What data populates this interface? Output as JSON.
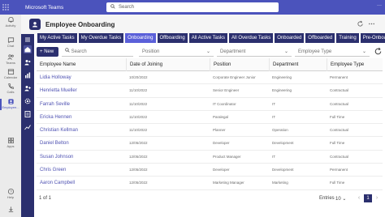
{
  "teams": {
    "app_name": "Microsoft Teams",
    "search_placeholder": "Search",
    "window_controls": "···",
    "rail": [
      {
        "label": "Activity",
        "icon": "bell-icon"
      },
      {
        "label": "Chat",
        "icon": "chat-icon"
      },
      {
        "label": "Teams",
        "icon": "teams-icon"
      },
      {
        "label": "Calendar",
        "icon": "calendar-icon"
      },
      {
        "label": "Calls",
        "icon": "phone-icon"
      },
      {
        "label": "Employee...",
        "icon": "app-icon"
      },
      {
        "label": "Apps",
        "icon": "apps-icon"
      },
      {
        "label": "Help",
        "icon": "help-icon"
      }
    ]
  },
  "app": {
    "title": "Employee Onboarding"
  },
  "tabs": [
    {
      "label": "My Active Tasks",
      "active": false
    },
    {
      "label": "My Overdue Tasks",
      "active": false
    },
    {
      "label": "Onboarding",
      "active": true
    },
    {
      "label": "Offboarding",
      "active": false
    },
    {
      "label": "All Active Tasks",
      "active": false
    },
    {
      "label": "All Overdue Tasks",
      "active": false
    },
    {
      "label": "Onboarded",
      "active": false
    },
    {
      "label": "Offboarded",
      "active": false
    },
    {
      "label": "Training",
      "active": false
    },
    {
      "label": "Pre-Onboarding",
      "active": false
    }
  ],
  "toolbar": {
    "new_label": "New",
    "search_placeholder": "Search",
    "position_placeholder": "Position",
    "department_placeholder": "Department",
    "employee_type_placeholder": "Employee Type"
  },
  "table": {
    "columns": [
      "Employee Name",
      "Date of Joining",
      "Position",
      "Department",
      "Employee Type"
    ],
    "rows": [
      [
        "Lidia Holloway",
        "10/20/2022",
        "Corporate Engineer Junior",
        "Engineering",
        "Permanent"
      ],
      [
        "Henrietta Mueller",
        "11/10/2022",
        "Senior Engineer",
        "Engineering",
        "Contractual"
      ],
      [
        "Farrah Seville",
        "11/10/2022",
        "IT Coordinator",
        "IT",
        "Contractual"
      ],
      [
        "Ericka Hennen",
        "11/10/2022",
        "Paralegal",
        "IT",
        "Full Time"
      ],
      [
        "Christian Kellman",
        "11/10/2022",
        "Planner",
        "Operation",
        "Contractual"
      ],
      [
        "Daniel Belton",
        "12/05/2022",
        "Developer",
        "Development",
        "Full Time"
      ],
      [
        "Susan Johnson",
        "12/05/2022",
        "Product Manager",
        "IT",
        "Contractual"
      ],
      [
        "Chris Green",
        "12/05/2022",
        "Developer",
        "Development",
        "Permanent"
      ],
      [
        "Aaron Campbell",
        "12/05/2022",
        "Marketing Manager",
        "Marketing",
        "Full Time"
      ]
    ]
  },
  "footer": {
    "page_text": "1 of 1",
    "entries_label": "Entries",
    "entries_value": "10",
    "current_page": "1",
    "prev": "‹",
    "next": "›"
  },
  "colors": {
    "teams_purple": "#4b53bc",
    "app_navy": "#2b2f6e",
    "active_tab": "#5b60d9",
    "link": "#4f52b2"
  }
}
